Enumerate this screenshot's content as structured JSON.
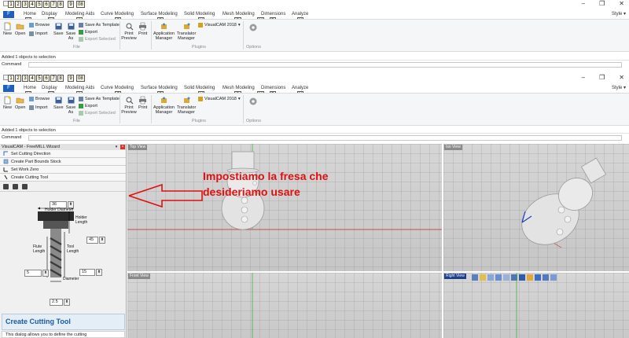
{
  "window": {
    "keytips_qat": [
      "1",
      "2",
      "3",
      "4",
      "5",
      "6",
      "7",
      "8",
      "9",
      "08"
    ],
    "controls": [
      "–",
      "❐",
      "✕"
    ]
  },
  "ribbon": {
    "file_tab": "F",
    "tabs": [
      "Home",
      "Display",
      "Modeling Aids",
      "Curve Modeling",
      "Surface Modeling",
      "Solid Modeling",
      "Mesh Modeling",
      "Dimensions",
      "Analyze"
    ],
    "tab_keytips": [
      "H",
      "V",
      "A",
      "C",
      "S",
      "U",
      "O",
      "M",
      "D",
      "N"
    ],
    "style_label": "Style ▾",
    "buttons": {
      "new": "New",
      "open": "Open",
      "browse": "Browse",
      "import": "Import",
      "save": "Save",
      "save_as": "Save As",
      "save_as_template": "Save As Template",
      "export": "Export",
      "export_selected": "Export Selected",
      "print_preview": "Print Preview",
      "print": "Print",
      "application_manager": "Application Manager",
      "translator_manager": "Translator Manager",
      "visualcam": "VisualCAM 2018"
    },
    "groups": {
      "file": "File",
      "plugins": "Plugins",
      "options": "Options"
    }
  },
  "status": {
    "message": "Added 1 objects to selection",
    "command_label": "Command"
  },
  "wizard": {
    "title": "VisualCAM - FreeMILL Wizard",
    "steps": [
      "Set Cutting Direction",
      "Create Part Bounds Stock",
      "Set Work Zero",
      "Create Cutting Tool"
    ],
    "holder_diameter": "36",
    "holder_length": "45",
    "flute_length": "5",
    "tool_length": "15",
    "diameter": "2.5",
    "labels": {
      "holder_diameter": "Holder Diameter",
      "holder_length": "Holder Length",
      "flute_length": "Flute Length",
      "tool_length": "Tool Length",
      "diameter": "Diameter"
    },
    "help_title": "Create Cutting Tool",
    "help_text": "This dialog allows you to define the cutting"
  },
  "viewports": {
    "top": "Top View",
    "iso": "Iso View",
    "front": "Front View",
    "right": "Right View"
  },
  "annotation": {
    "line1": "Impostiamo la fresa che",
    "line2": "desideriamo usare"
  },
  "colors": {
    "accent": "#1f5fbf",
    "annotation": "#e01010",
    "viewport_bg": "#cfcfcf"
  }
}
